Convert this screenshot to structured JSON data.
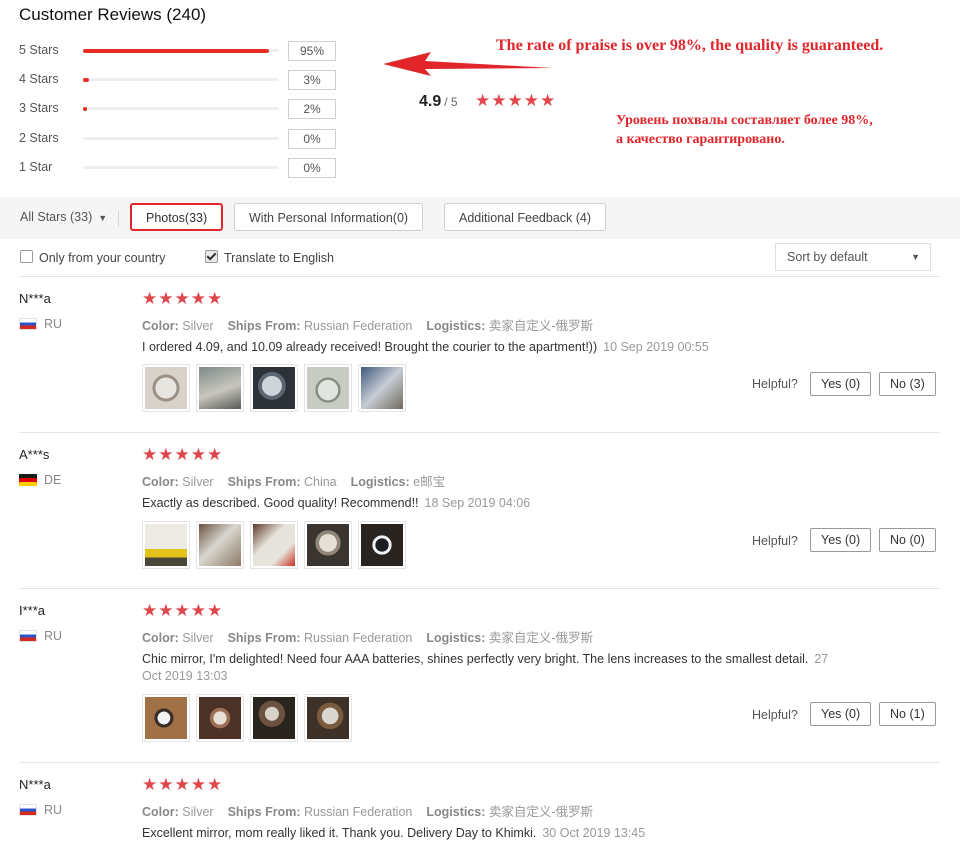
{
  "header": {
    "title": "Customer Reviews (240)"
  },
  "distribution": [
    {
      "label": "5 Stars",
      "percent_text": "95%",
      "fraction": 0.95
    },
    {
      "label": "4 Stars",
      "percent_text": "3%",
      "fraction": 0.03
    },
    {
      "label": "3 Stars",
      "percent_text": "2%",
      "fraction": 0.02
    },
    {
      "label": "2 Stars",
      "percent_text": "0%",
      "fraction": 0
    },
    {
      "label": "1 Star",
      "percent_text": "0%",
      "fraction": 0
    }
  ],
  "average": {
    "score": "4.9",
    "denominator": "/ 5",
    "stars": 5
  },
  "promo": {
    "english": "The rate of praise is over 98%, the quality is guaranteed.",
    "russian_line1": "Уровень похвалы составляет более 98%,",
    "russian_line2": "а качество гарантировано."
  },
  "filters": {
    "all_stars": "All Stars (33)",
    "photos": "Photos(33)",
    "personal": "With Personal Information(0)",
    "additional": "Additional Feedback (4)",
    "only_country": "Only from your country",
    "translate": "Translate to English",
    "sort": "Sort by default"
  },
  "labels": {
    "color": "Color:",
    "ships_from": "Ships From:",
    "logistics": "Logistics:",
    "helpful": "Helpful?"
  },
  "reviews": [
    {
      "name": "N***a",
      "country": "RU",
      "color": "Silver",
      "ships_from": "Russian Federation",
      "logistics": "卖家自定义-俄罗斯",
      "text": "I ordered 4.09, and 10.09 already received! Brought the courier to the apartment!))",
      "date": "10 Sep 2019 00:55",
      "yes": "Yes (0)",
      "no": "No (3)"
    },
    {
      "name": "A***s",
      "country": "DE",
      "color": "Silver",
      "ships_from": "China",
      "logistics": "e邮宝",
      "text": "Exactly as described. Good quality! Recommend!!",
      "date": "18 Sep 2019 04:06",
      "yes": "Yes (0)",
      "no": "No (0)"
    },
    {
      "name": "I***a",
      "country": "RU",
      "color": "Silver",
      "ships_from": "Russian Federation",
      "logistics": "卖家自定义-俄罗斯",
      "text": "Chic mirror, I'm delighted! Need four AAA batteries, shines perfectly very bright. The lens increases to the smallest detail.",
      "date": "27 Oct 2019 13:03",
      "yes": "Yes (0)",
      "no": "No (1)"
    },
    {
      "name": "N***a",
      "country": "RU",
      "color": "Silver",
      "ships_from": "Russian Federation",
      "logistics": "卖家自定义-俄罗斯",
      "text": "Excellent mirror, mom really liked it. Thank you. Delivery Day to Khimki.",
      "date": "30 Oct 2019 13:45"
    }
  ],
  "colors": {
    "accent": "#e1262b",
    "star": "#e0474c",
    "bar": "#e62e24"
  }
}
